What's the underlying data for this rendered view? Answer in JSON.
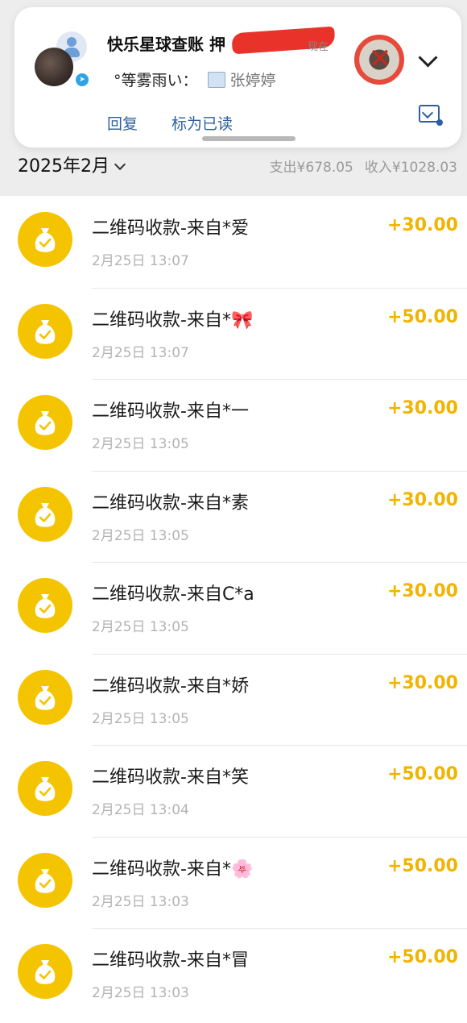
{
  "notification": {
    "title": "快乐星球查账 押",
    "time": "现在",
    "sender": "°等雾雨い：",
    "sender_suffix": "张婷婷",
    "actions": {
      "reply": "回复",
      "mark_read": "标为已读"
    }
  },
  "header": {
    "month": "2025年2月",
    "expense": "支出¥678.05",
    "income": "收入¥1028.03"
  },
  "colors": {
    "coin": "#f5c400",
    "amount": "#f2b400",
    "action": "#2f5f9e"
  },
  "transactions": [
    {
      "title": "二维码收款-来自*爱",
      "time": "2月25日 13:07",
      "amount": "+30.00",
      "icon": "money-bag-icon"
    },
    {
      "title": "二维码收款-来自*🎀",
      "time": "2月25日 13:07",
      "amount": "+50.00",
      "icon": "money-bag-icon"
    },
    {
      "title": "二维码收款-来自*一",
      "time": "2月25日 13:05",
      "amount": "+30.00",
      "icon": "money-bag-icon"
    },
    {
      "title": "二维码收款-来自*素",
      "time": "2月25日 13:05",
      "amount": "+30.00",
      "icon": "money-bag-icon"
    },
    {
      "title": "二维码收款-来自C*a",
      "time": "2月25日 13:05",
      "amount": "+30.00",
      "icon": "money-bag-icon"
    },
    {
      "title": "二维码收款-来自*娇",
      "time": "2月25日 13:05",
      "amount": "+30.00",
      "icon": "money-bag-icon"
    },
    {
      "title": "二维码收款-来自*笑",
      "time": "2月25日 13:04",
      "amount": "+50.00",
      "icon": "money-bag-icon"
    },
    {
      "title": "二维码收款-来自*🌸",
      "time": "2月25日 13:03",
      "amount": "+50.00",
      "icon": "money-bag-icon"
    },
    {
      "title": "二维码收款-来自*冒",
      "time": "2月25日 13:03",
      "amount": "+50.00",
      "icon": "money-bag-icon"
    }
  ]
}
